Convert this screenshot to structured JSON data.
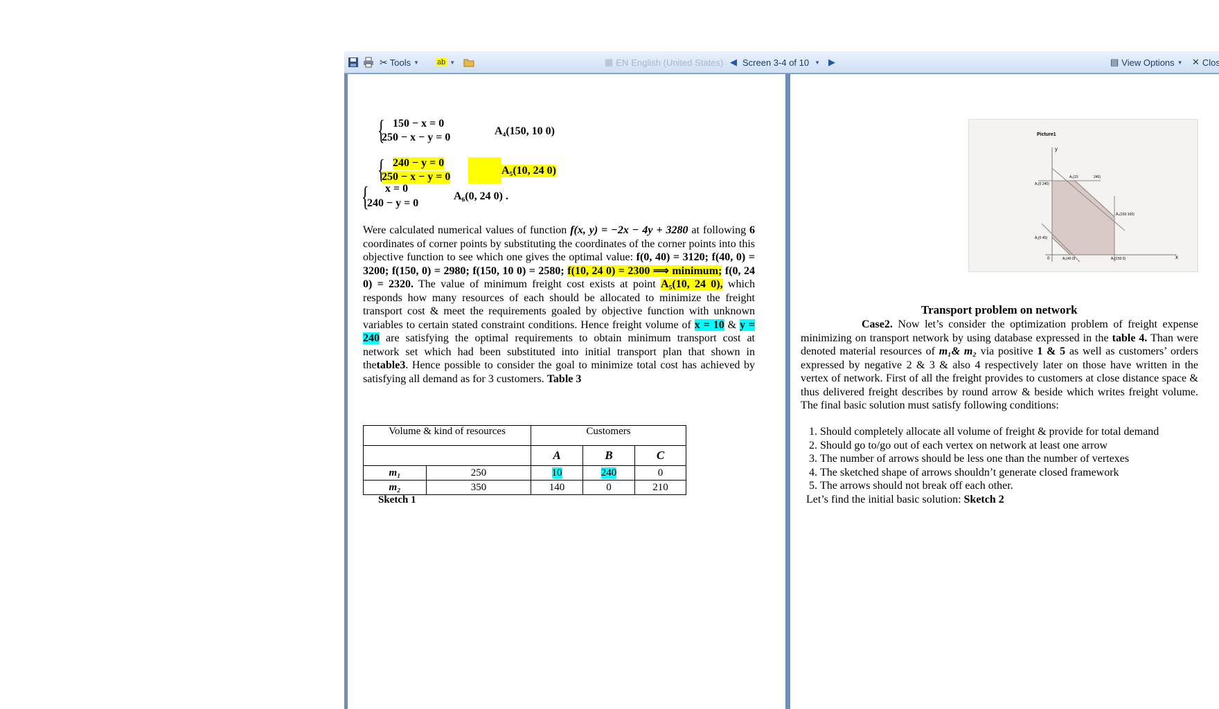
{
  "toolbar": {
    "tools_label": "Tools",
    "language_code": "EN",
    "language_name": "English (United States)",
    "screen_label": "Screen 3-4 of 10",
    "view_options_label": "View Options",
    "close_label": "Close"
  },
  "left_page": {
    "sys1": {
      "eq1": "150 − x = 0",
      "eq2": "250 − x − y = 0",
      "result": "A₄(150,  10 0)"
    },
    "sys2": {
      "eq1": "240 − y = 0",
      "eq2": "250 − x − y = 0",
      "result": "A₅(10,   24 0)"
    },
    "sys3": {
      "eq1": "x = 0",
      "eq2": "240 − y = 0",
      "result": "A₆(0,   24 0) ."
    },
    "paragraph": {
      "p1": "Were calculated numerical values of function",
      "func": "f(x, y) = −2x − 4y + 3280",
      "p2": "at following",
      "six": "6",
      "p3": "coordinates of corner points by substituting the coordinates of the corner points into this objective function to see which one gives the optimal value:",
      "v1": "f(0,  40) = 3120;",
      "v2": "f(40,  0) = 3200;",
      "v3": "f(150,  0) = 2980;",
      "v4": "f(150,  10 0) = 2580;",
      "v5": "f(10,   24 0) = 2300 ⟹ minimum;",
      "v6": "f(0,   24 0) = 2320.",
      "p4": "The value of minimum freight cost exists at point",
      "point": "A₅(10,   24 0),",
      "p5": "which responds how many resources of each should be allocated to minimize the freight transport cost & meet the requirements goaled by objective function with unknown variables to certain stated constraint conditions. Hence freight volume of",
      "x_val": "x = 10",
      "amp": "&",
      "y_val": "y = 240",
      "p6": "are satisfying the optimal requirements to obtain minimum transport cost at network set which had been substituted into initial transport plan that shown in the",
      "table_ref": "table3",
      "p7": ". Hence possible to consider the goal to minimize total cost has achieved by satisfying all demand as for 3 customers.",
      "table_title": "Table 3"
    },
    "table": {
      "header_resources": "Volume & kind of resources",
      "header_customers": "Customers",
      "customer_cols": [
        "A",
        "B",
        "C"
      ],
      "rows": [
        {
          "name": "m₁",
          "volume": "250",
          "a": "10",
          "b": "240",
          "c": "0"
        },
        {
          "name": "m₂",
          "volume": "350",
          "a": "140",
          "b": "0",
          "c": "210"
        }
      ]
    },
    "sketch_label": "Sketch 1"
  },
  "right_page": {
    "figure": {
      "caption": "Picture1",
      "axis_y": "y",
      "axis_x": "x",
      "zero": "0",
      "labels": {
        "a1": "A₁(0   240)",
        "a2": "A₅(10",
        "a2b": "240)",
        "a3": "A₄(150   100)",
        "a4": "A₁(0   40)",
        "a5": "A₂(40   0)",
        "a6": "A₃(150   0)"
      }
    },
    "heading": "Transport problem on network",
    "case_label": "Case2.",
    "case_text": "Now let’s consider the optimization problem of freight expense minimizing on transport network by using database expressed in the",
    "table4": "table 4.",
    "text2": "Than were denoted material resources of",
    "m_vars": "m₁& m₂",
    "text3": "via positive",
    "positives": "1 & 5",
    "text4": "as well as customers’ orders expressed by negative 2 & 3 & also 4 respectively later on those have written in the vertex of network. First of all the freight provides to customers at close distance space & thus delivered freight describes by round arrow & beside which writes freight volume. The final basic solution must satisfy following conditions:",
    "conditions": [
      "Should completely allocate all volume of freight & provide for total demand",
      "Should go to/go out of each vertex on network at least one arrow",
      "The number of arrows should be less one than the number of vertexes",
      "The sketched shape of arrows shouldn’t generate closed framework",
      "The arrows should not break off each other."
    ],
    "final_text": "Let’s find the initial basic solution:",
    "sketch_label": "Sketch 2"
  }
}
